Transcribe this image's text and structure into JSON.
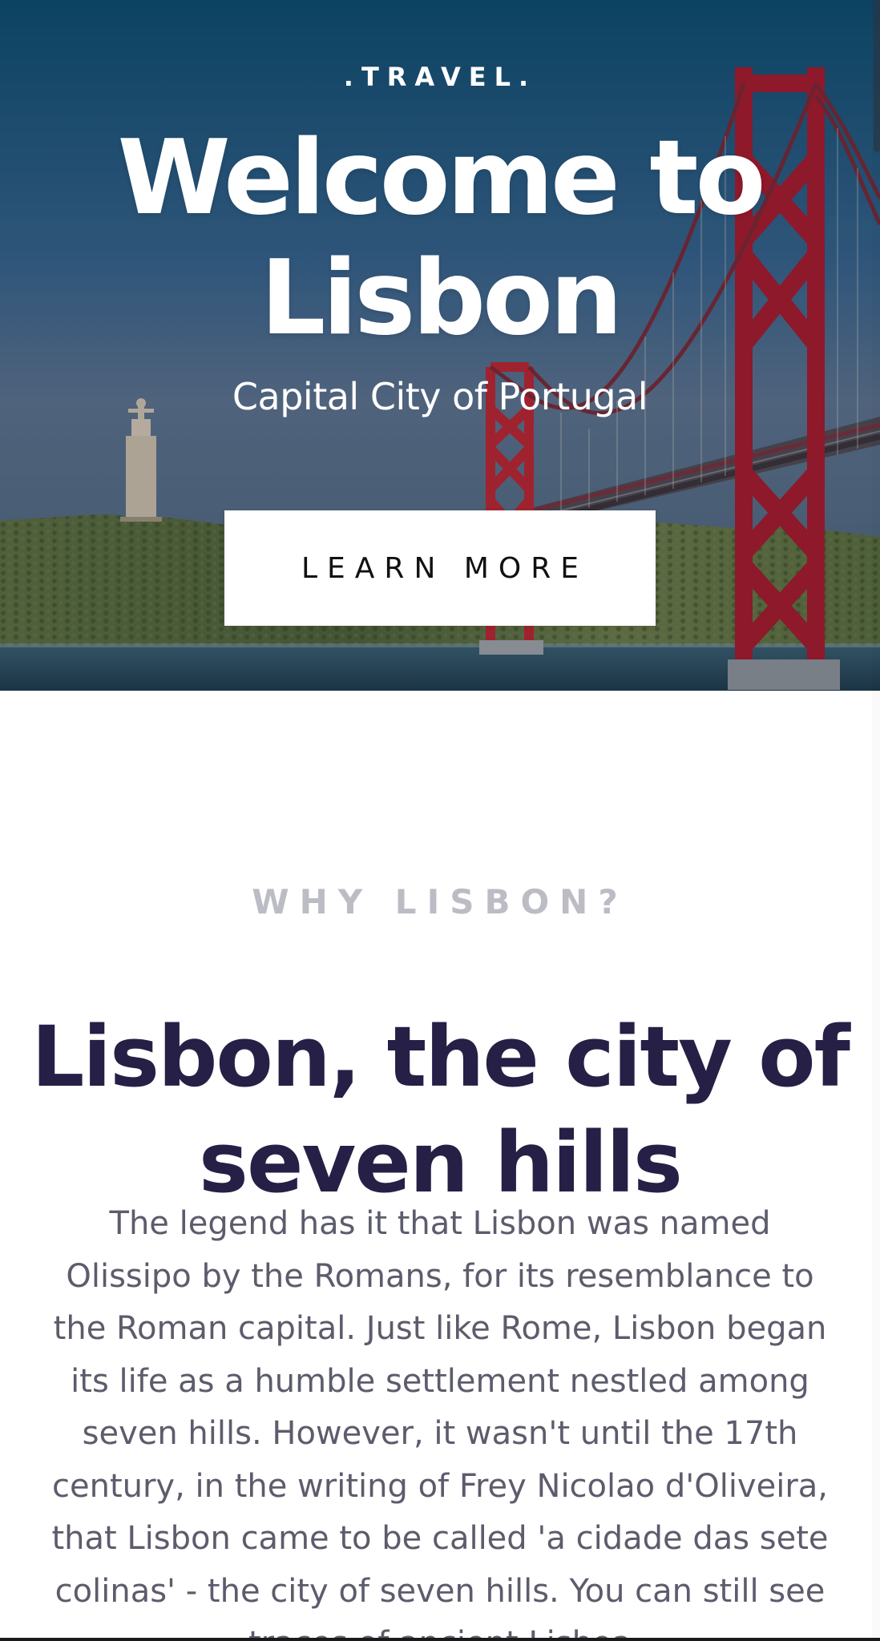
{
  "hero": {
    "eyebrow": ".TRAVEL.",
    "title": "Welcome to Lisbon",
    "subtitle": "Capital City of Portugal",
    "cta_label": "LEARN MORE"
  },
  "intro": {
    "label": "WHY LISBON?",
    "title": "Lisbon, the city of seven hills",
    "body": "The legend has it that Lisbon was named Olissipo by the Romans, for its resemblance to the Roman capital. Just like Rome, Lisbon began its life as a humble settlement nestled among seven hills. However, it wasn't until the 17th century, in the writing of Frey Nicolao d'Oliveira, that Lisbon came to be called 'a cidade das sete colinas' - the city of seven hills. You can still see traces of ancient Lisboa"
  },
  "icons": {
    "bridge": "suspension-bridge-image",
    "statue": "cristo-rei-statue-image"
  }
}
